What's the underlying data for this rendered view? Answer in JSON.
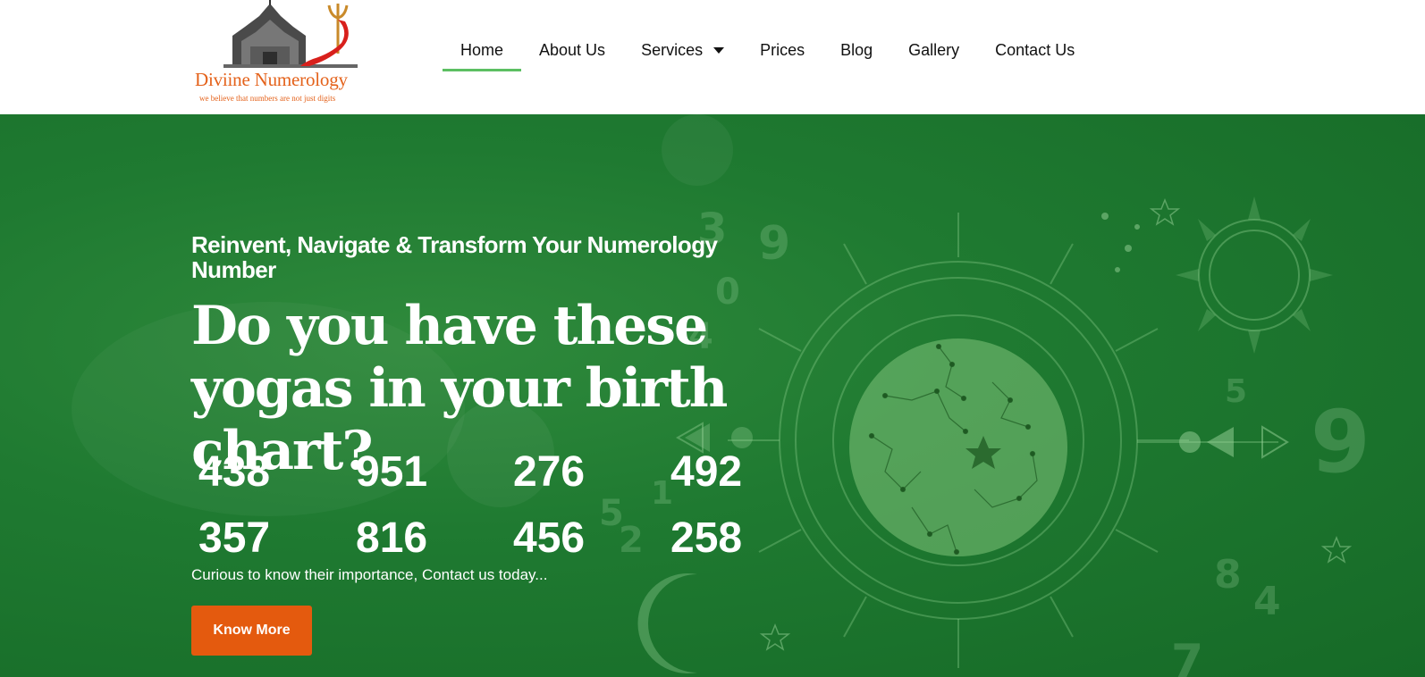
{
  "brand": {
    "name": "Diviine Numerology",
    "tagline": "we believe that numbers are not just digits",
    "accent": "#e4621b"
  },
  "nav": {
    "items": [
      {
        "label": "Home",
        "active": true
      },
      {
        "label": "About Us"
      },
      {
        "label": "Services",
        "has_dropdown": true
      },
      {
        "label": "Prices"
      },
      {
        "label": "Blog"
      },
      {
        "label": "Gallery"
      },
      {
        "label": "Contact Us"
      }
    ],
    "active_color": "#5cbf62"
  },
  "hero": {
    "eyebrow": "Reinvent, Navigate & Transform Your Numerology Number",
    "headline": "Do you have these yogas in your birth chart?",
    "numbers": [
      "438",
      "951",
      "276",
      "492",
      "357",
      "816",
      "456",
      "258"
    ],
    "subtext": "Curious to know their importance, Contact us today...",
    "cta_label": "Know More",
    "cta_color": "#e45a0e",
    "background_color": "#1f7a31",
    "bg_digits": [
      "3",
      "9",
      "0",
      "4",
      "5",
      "1",
      "2",
      "5",
      "9",
      "8",
      "4",
      "7"
    ]
  }
}
